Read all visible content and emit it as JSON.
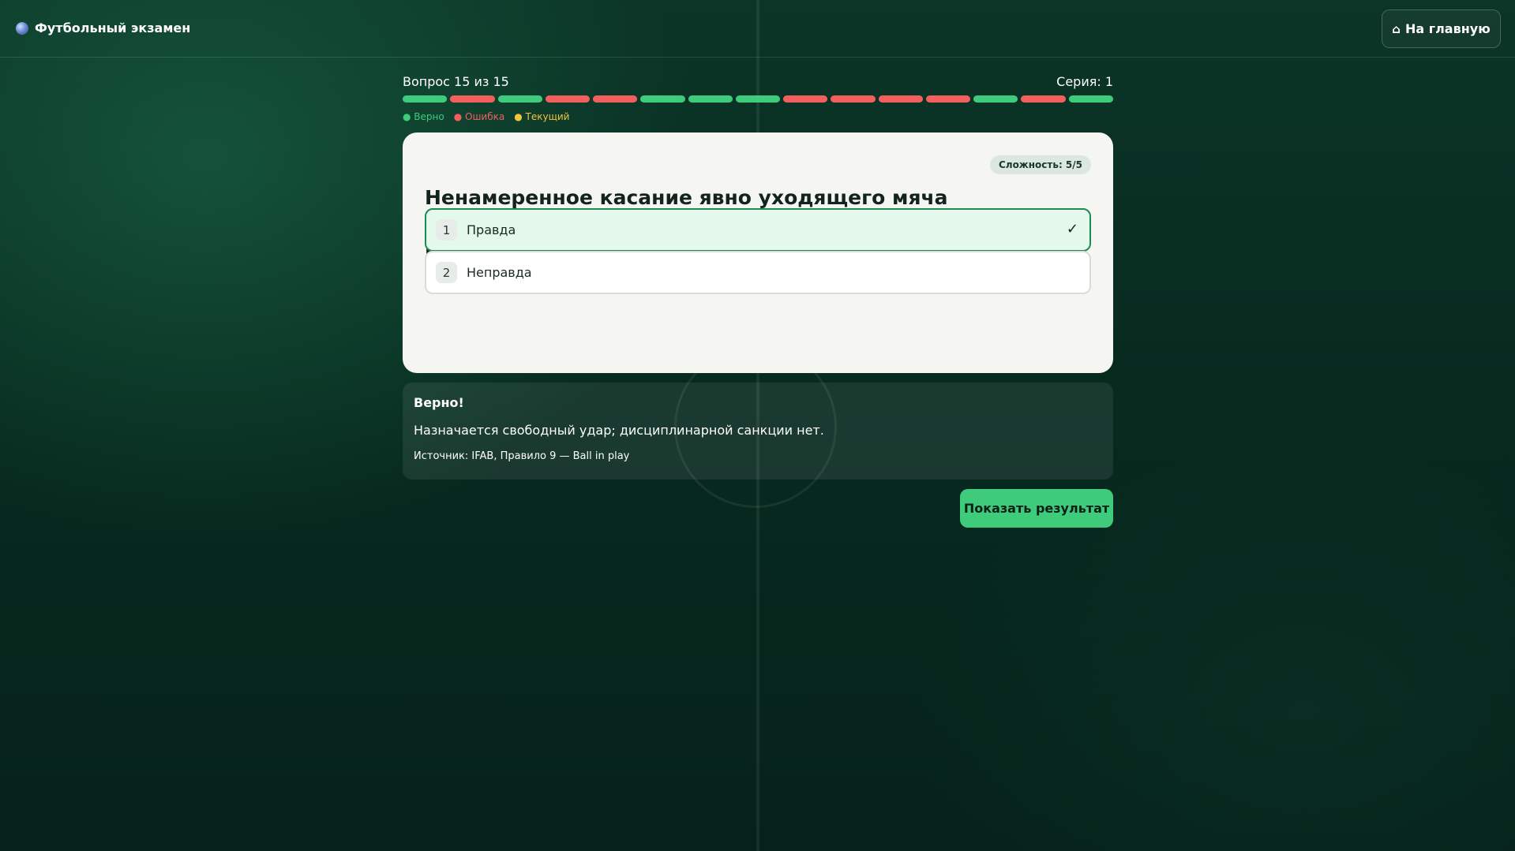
{
  "header": {
    "brand_title": "Футбольный экзамен",
    "brand_icon": "soccer-ball-icon",
    "home_button_label": "На главную",
    "home_icon": "home-icon"
  },
  "progress": {
    "question_counter": "Вопрос 15 из 15",
    "streak": "Серия: 1",
    "current": 15,
    "total": 15,
    "segments": [
      "correct",
      "wrong",
      "correct",
      "wrong",
      "wrong",
      "correct",
      "correct",
      "correct",
      "wrong",
      "wrong",
      "wrong",
      "wrong",
      "correct",
      "wrong",
      "correct"
    ],
    "legend": {
      "correct": "● Верно",
      "wrong": "● Ошибка",
      "current": "● Текущий"
    },
    "colors": {
      "correct": "#3ecb7b",
      "wrong": "#f2605e",
      "current": "#f0c43b"
    }
  },
  "question": {
    "difficulty": "Сложность: 5/5",
    "text": "Ненамеренное касание явно уходящего мяча запасным наказывается свободным ударом без карточки.",
    "options": [
      {
        "number": "1",
        "label": "Правда",
        "selected": true,
        "mark": "✓"
      },
      {
        "number": "2",
        "label": "Неправда",
        "selected": false,
        "mark": ""
      }
    ]
  },
  "feedback": {
    "title": "Верно!",
    "explanation": "Назначается свободный удар; дисциплинарной санкции нет.",
    "source": "Источник: IFAB, Правило 9 — Ball in play"
  },
  "actions": {
    "show_result_label": "Показать результат"
  }
}
